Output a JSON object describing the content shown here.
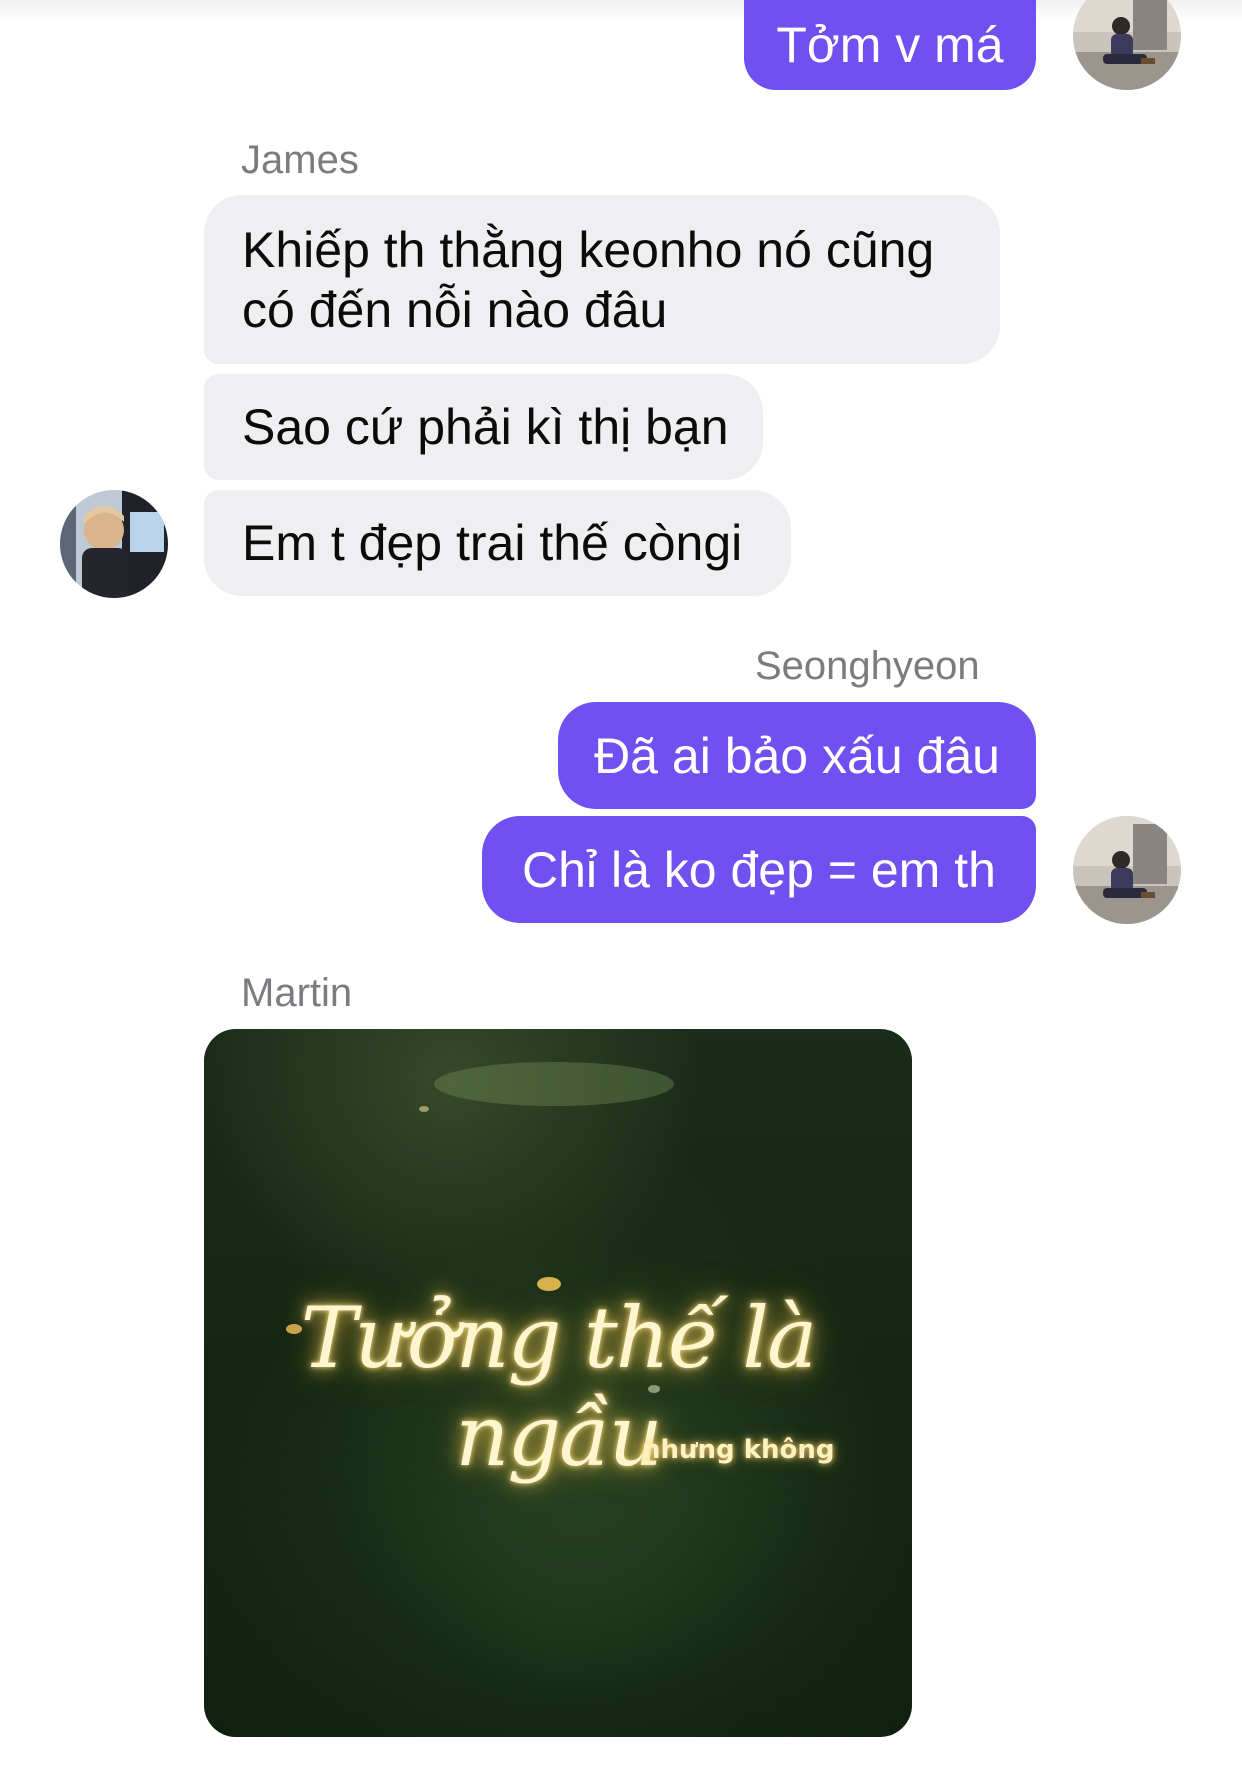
{
  "conversation": {
    "messages": [
      {
        "direction": "outgoing",
        "text": "Tởm v má"
      },
      {
        "sender": "James"
      },
      {
        "direction": "incoming",
        "text": "Khiếp th thằng keonho nó cũng có đến nỗi nào đâu"
      },
      {
        "direction": "incoming",
        "text": "Sao cứ phải kì thị bạn"
      },
      {
        "direction": "incoming",
        "text": "Em t đẹp trai thế còngi"
      },
      {
        "sender": "Seonghyeon"
      },
      {
        "direction": "outgoing",
        "text": "Đã ai bảo xấu đâu"
      },
      {
        "direction": "outgoing",
        "text": "Chỉ là ko đẹp = em th"
      },
      {
        "sender": "Martin"
      },
      {
        "direction": "incoming",
        "type": "image",
        "image_title": "Tưởng thế là ngầu",
        "image_subtitle": "nhưng không"
      }
    ]
  },
  "colors": {
    "outgoing_bubble": "#7050f0",
    "incoming_bubble": "#efeff2",
    "sender_name": "#7c7c80"
  },
  "icons": {
    "self_avatar": "avatar-photo-person-sitting",
    "james_avatar": "avatar-photo-person-in-car"
  }
}
